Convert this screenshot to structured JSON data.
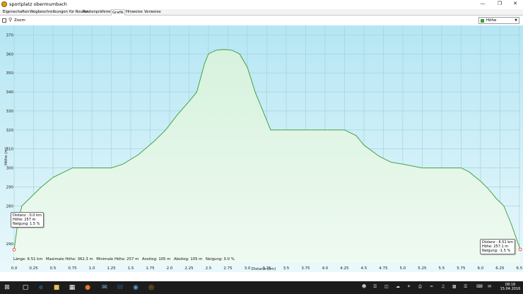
{
  "window": {
    "title": "sportplatz obermumbach",
    "controls": [
      "—",
      "❐",
      "✕"
    ]
  },
  "tabs": [
    {
      "label": "Eigenschaften",
      "active": false
    },
    {
      "label": "Wegbeschreibungen für Routen",
      "active": false
    },
    {
      "label": "Routenpräferenz",
      "active": false
    },
    {
      "label": "Grafik",
      "active": true
    },
    {
      "label": "Hinweise",
      "active": false
    },
    {
      "label": "Verweise",
      "active": false
    }
  ],
  "toolbar": {
    "zoom_label": "Zoom",
    "series_select": "Höhe"
  },
  "summary": {
    "length": "Länge: 6.51 km",
    "max_height": "Maximale Höhe: 362.3 m",
    "min_height": "Minimale Höhe: 257 m",
    "ascent": "Anstieg: 105 m",
    "descent": "Abstieg: 105 m",
    "grade": "Neigung: 0.0 %"
  },
  "start_info": {
    "line1": "Distanz : 0.0 km",
    "line2": "Höhe: 257 m",
    "line3": "Neigung: 1.5 %"
  },
  "end_info": {
    "line1": "Distanz : 6.51 km",
    "line2": "Höhe: 257.1 m",
    "line3": "Neigung: -1.5 %"
  },
  "chart_data": {
    "type": "area",
    "xlabel": "Distanz  (km)",
    "ylabel": "Höhe (m)",
    "xlim": [
      0,
      6.51
    ],
    "ylim": [
      250,
      375
    ],
    "x_ticks": [
      "0.0",
      "0.25",
      "0.5",
      "0.75",
      "1.0",
      "1.25",
      "1.5",
      "1.75",
      "2.0",
      "2.25",
      "2.5",
      "2.75",
      "3.0",
      "3.25",
      "3.5",
      "3.75",
      "4.0",
      "4.25",
      "4.5",
      "4.75",
      "5.0",
      "5.25",
      "5.5",
      "5.75",
      "6.0",
      "6.25",
      "6.5"
    ],
    "y_ticks": [
      "290",
      "280",
      "290",
      "300",
      "310",
      "320",
      "330",
      "340",
      "350",
      "360",
      "370"
    ],
    "y_tick_values": [
      260,
      280,
      290,
      300,
      310,
      320,
      330,
      340,
      350,
      360,
      370
    ],
    "grid": true,
    "series": [
      {
        "color": "#44a244",
        "x": [
          0.0,
          0.05,
          0.1,
          0.2,
          0.35,
          0.5,
          0.65,
          0.75,
          0.9,
          1.1,
          1.25,
          1.4,
          1.6,
          1.8,
          1.95,
          2.1,
          2.25,
          2.35,
          2.45,
          2.5,
          2.6,
          2.7,
          2.8,
          2.9,
          3.0,
          3.1,
          3.2,
          3.3,
          3.4,
          3.5,
          3.7,
          4.0,
          4.25,
          4.4,
          4.5,
          4.7,
          4.85,
          5.0,
          5.25,
          5.5,
          5.75,
          5.85,
          6.0,
          6.1,
          6.2,
          6.3,
          6.4,
          6.51
        ],
        "values": [
          257,
          272,
          280,
          284,
          290,
          295,
          298,
          300,
          300,
          300,
          300,
          302,
          307,
          314,
          320,
          328,
          335,
          340,
          355,
          360,
          362,
          362.3,
          362,
          360,
          353,
          340,
          330,
          320,
          320,
          320,
          320,
          320,
          320,
          317,
          312,
          306,
          303,
          302,
          300,
          300,
          300,
          298,
          293,
          289,
          284,
          280,
          270,
          257.1
        ]
      }
    ]
  },
  "taskbar": {
    "time": "08:18",
    "date": "15.04.2016"
  }
}
